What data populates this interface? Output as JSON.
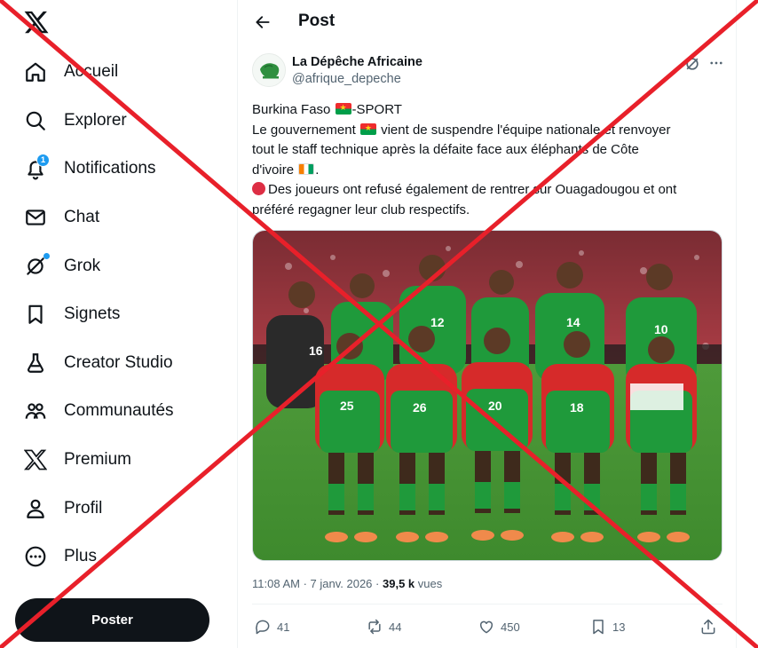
{
  "nav": {
    "items": [
      {
        "key": "home",
        "label": "Accueil",
        "icon": "home-icon"
      },
      {
        "key": "explore",
        "label": "Explorer",
        "icon": "search-icon"
      },
      {
        "key": "notifications",
        "label": "Notifications",
        "icon": "bell-icon",
        "badge": "1"
      },
      {
        "key": "chat",
        "label": "Chat",
        "icon": "envelope-icon"
      },
      {
        "key": "grok",
        "label": "Grok",
        "icon": "grok-icon"
      },
      {
        "key": "bookmarks",
        "label": "Signets",
        "icon": "bookmark-icon"
      },
      {
        "key": "creator",
        "label": "Creator Studio",
        "icon": "flask-icon"
      },
      {
        "key": "communities",
        "label": "Communautés",
        "icon": "people-icon"
      },
      {
        "key": "premium",
        "label": "Premium",
        "icon": "x-logo-icon"
      },
      {
        "key": "profile",
        "label": "Profil",
        "icon": "person-icon"
      },
      {
        "key": "more",
        "label": "Plus",
        "icon": "more-circle-icon"
      }
    ],
    "post_button": "Poster"
  },
  "header": {
    "title": "Post"
  },
  "tweet": {
    "author_name": "La Dépêche Africaine",
    "author_handle": "@afrique_depeche",
    "text": {
      "l1a": "Burkina Faso ",
      "l1b": "-SPORT",
      "l2a": "Le gouvernement ",
      "l2b": " vient de suspendre l'équipe nationale et renvoyer",
      "l3": "tout le staff technique après la défaite face aux éléphants de Côte",
      "l4": "d'ivoire ",
      "l4b": ".",
      "l5": "Des joueurs ont refusé également de rentrer sur  Ouagadougou et ont",
      "l6": "préféré regagner leur club respectifs."
    },
    "time": "11:08 AM",
    "date": "7 janv. 2026",
    "views_count": "39,5 k",
    "views_label": "vues",
    "replies": "41",
    "reposts": "44",
    "likes": "450",
    "bookmarks": "13"
  },
  "colors": {
    "accent": "#1d9bf0",
    "overlay_red": "#e8202a",
    "jersey_green": "#1f9a3b",
    "jersey_red": "#d62a2a"
  }
}
